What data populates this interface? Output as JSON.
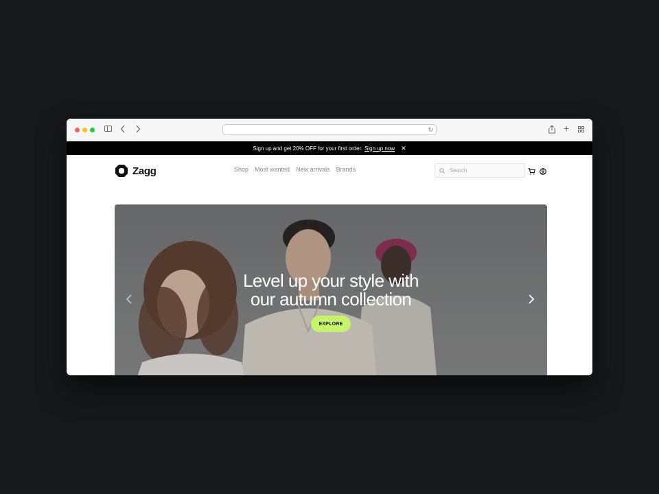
{
  "browser": {
    "address": ""
  },
  "promo": {
    "text": "Sign up and get 20% OFF for your first order.",
    "link": "Sign up now",
    "close": "✕"
  },
  "brand": {
    "name": "Zagg"
  },
  "nav": {
    "items": [
      "Shop",
      "Most wanted",
      "New arrivals",
      "Brands"
    ]
  },
  "search": {
    "placeholder": "Search"
  },
  "hero": {
    "headline": "Level up your style with\nour autumn collection",
    "cta": "EXPLORE",
    "cta_color": "#c6f46a"
  },
  "icons": {
    "prev": "chevron-left-icon",
    "next": "chevron-right-icon",
    "cart": "cart-icon",
    "user": "user-icon",
    "search": "search-icon"
  }
}
